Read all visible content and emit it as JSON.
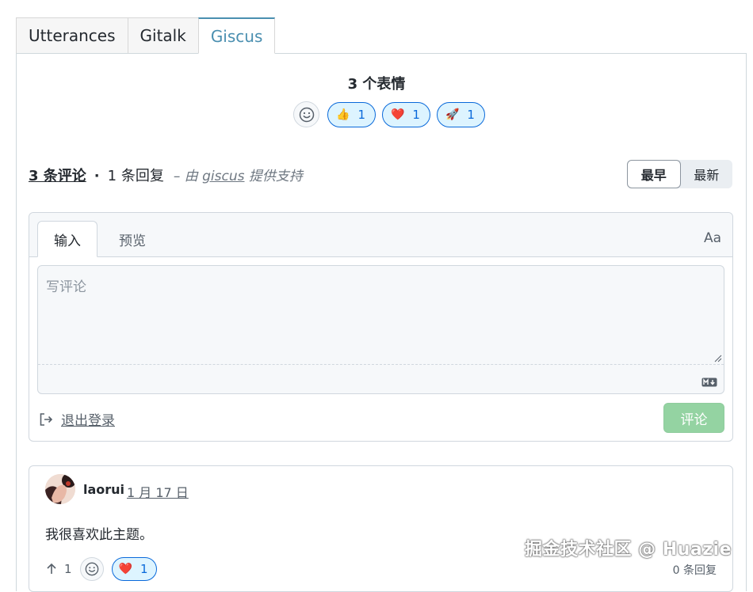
{
  "tabs": [
    "Utterances",
    "Gitalk",
    "Giscus"
  ],
  "reactions": {
    "title": "3 个表情",
    "items": [
      {
        "emoji": "👍",
        "count": "1"
      },
      {
        "emoji": "❤️",
        "count": "1"
      },
      {
        "emoji": "🚀",
        "count": "1"
      }
    ]
  },
  "header": {
    "comment_count": "3 条评论",
    "separator": "·",
    "reply_count": "1 条回复",
    "powered_prefix": "– 由",
    "powered_brand": "giscus",
    "powered_suffix": "提供支持",
    "sort_oldest": "最早",
    "sort_newest": "最新"
  },
  "editor": {
    "tab_write": "输入",
    "tab_preview": "预览",
    "format_label": "Aa",
    "placeholder": "写评论",
    "signout_label": "退出登录",
    "submit_label": "评论"
  },
  "comment": {
    "author": "laorui",
    "date": "1 月 17 日",
    "body": "我很喜欢此主题。",
    "upvotes": "1",
    "reaction_emoji": "❤️",
    "reaction_count": "1",
    "replies": "0 条回复"
  },
  "watermark": "掘金技术社区 @ Huazie",
  "colors": {
    "accent": "#4a8fb0",
    "link_blue": "#0969da",
    "submit_green": "#94d3a2"
  }
}
